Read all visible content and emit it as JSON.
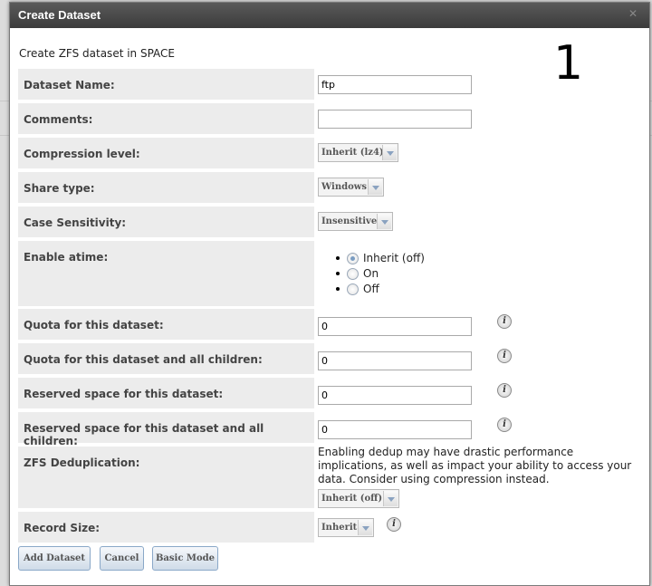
{
  "dialog": {
    "title": "Create Dataset",
    "close_icon": "close-icon",
    "heading": "Create ZFS dataset in SPACE",
    "annotation_number": "1"
  },
  "fields": {
    "dataset_name": {
      "label": "Dataset Name:",
      "value": "ftp"
    },
    "comments": {
      "label": "Comments:",
      "value": ""
    },
    "compression": {
      "label": "Compression level:",
      "value": "Inherit (lz4)"
    },
    "share_type": {
      "label": "Share type:",
      "value": "Windows"
    },
    "case_sensitivity": {
      "label": "Case Sensitivity:",
      "value": "Insensitive"
    },
    "atime": {
      "label": "Enable atime:",
      "options": [
        "Inherit (off)",
        "On",
        "Off"
      ],
      "selected": "Inherit (off)"
    },
    "quota": {
      "label": "Quota for this dataset:",
      "value": "0"
    },
    "quota_children": {
      "label": "Quota for this dataset and all children:",
      "value": "0"
    },
    "reserved": {
      "label": "Reserved space for this dataset:",
      "value": "0"
    },
    "reserved_children": {
      "label": "Reserved space for this dataset and all children:",
      "value": "0"
    },
    "dedup": {
      "label": "ZFS Deduplication:",
      "note": "Enabling dedup may have drastic performance implications, as well as impact your ability to access your data. Consider using compression instead.",
      "value": "Inherit (off)"
    },
    "record_size": {
      "label": "Record Size:",
      "value": "Inherit"
    }
  },
  "buttons": {
    "add": "Add Dataset",
    "cancel": "Cancel",
    "basic": "Basic Mode"
  },
  "colors": {
    "titlebar": "#3b3b3b",
    "label_bg": "#ececec",
    "button_border": "#8aa8c8"
  }
}
